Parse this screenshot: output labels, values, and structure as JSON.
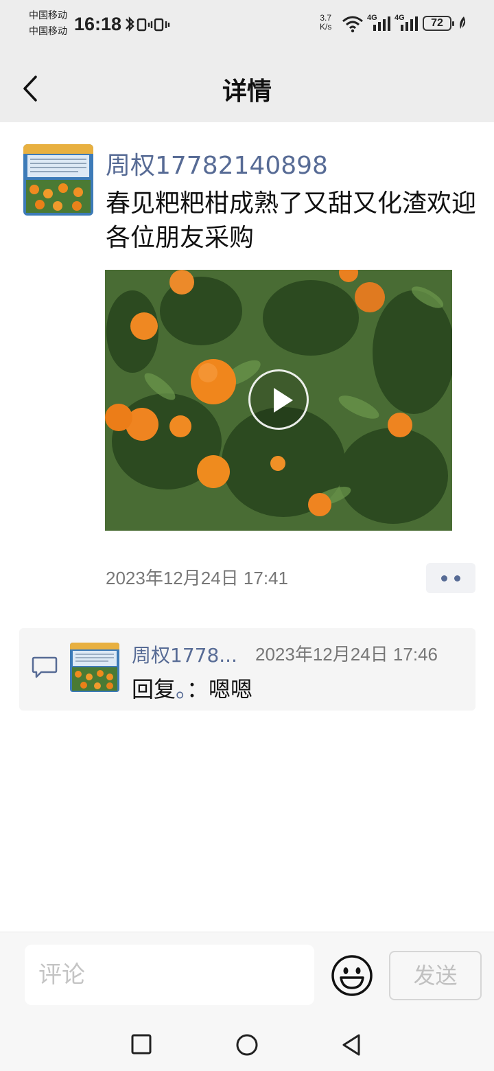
{
  "status_bar": {
    "carrier_1": "中国移动",
    "carrier_2": "中国移动",
    "time": "16:18",
    "net_speed_value": "3.7",
    "net_speed_unit": "K/s",
    "network_1": "4G",
    "network_2": "4G",
    "battery": "72"
  },
  "header": {
    "title": "详情"
  },
  "post": {
    "author": "周权17782140898",
    "text": "春见粑粑柑成熟了又甜又化渣欢迎各位朋友采购",
    "timestamp": "2023年12月24日 17:41"
  },
  "comments": [
    {
      "author": "周权1778...",
      "time": "2023年12月24日 17:46",
      "reply_label": "回复",
      "dot": "。",
      "colon": "：",
      "text": "嗯嗯"
    }
  ],
  "comment_bar": {
    "placeholder": "评论",
    "send_label": "发送"
  },
  "colors": {
    "accent_name": "#576b95",
    "background_gray": "#ededed"
  }
}
